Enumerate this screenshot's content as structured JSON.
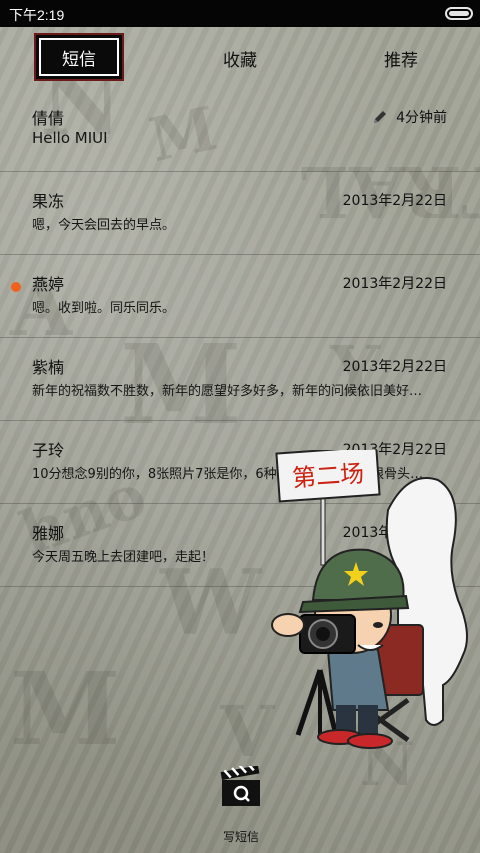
{
  "status_bar": {
    "time": "下午2:19"
  },
  "tabs": [
    {
      "label": "短信",
      "active": true
    },
    {
      "label": "收藏",
      "active": false
    },
    {
      "label": "推荐",
      "active": false
    }
  ],
  "threads": [
    {
      "name": "倩倩",
      "preview": "Hello MIUI",
      "time": "4分钟前",
      "draft": true,
      "unread": false
    },
    {
      "name": "果冻",
      "preview": "嗯，今天会回去的早点。",
      "time": "2013年2月22日",
      "draft": false,
      "unread": false
    },
    {
      "name": "燕婷",
      "preview": "嗯。收到啦。同乐同乐。",
      "time": "2013年2月22日",
      "draft": false,
      "unread": true
    },
    {
      "name": "紫楠",
      "preview": "新年的祝福数不胜数，新年的愿望好多好多，新年的问候依旧美好…",
      "time": "2013年2月22日",
      "draft": false,
      "unread": false
    },
    {
      "name": "子玲",
      "preview": "10分想念9别的你，8张照片7张是你，6种小狗5只像你，4根骨头…",
      "time": "2013年2月22日",
      "draft": false,
      "unread": false
    },
    {
      "name": "雅娜",
      "preview": "今天周五晚上去团建吧，走起！",
      "time": "2013年2月22日",
      "draft": false,
      "unread": false
    }
  ],
  "compose": {
    "label": "写短信",
    "icon": "clapperboard-icon"
  },
  "decoration": {
    "sign_text": "第二场"
  },
  "colors": {
    "unread_dot": "#f0611d",
    "status_bar": "#050505",
    "active_tab": "#0a0a0a"
  }
}
